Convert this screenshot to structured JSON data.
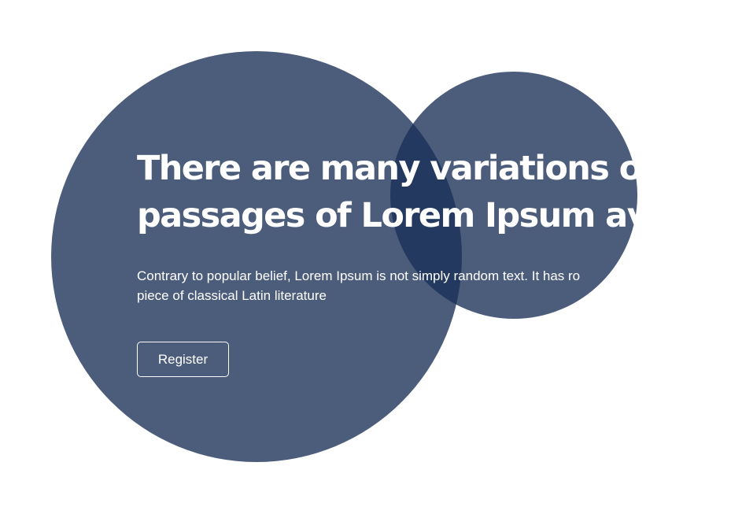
{
  "hero": {
    "headline_line1": "There are many variations of",
    "headline_line2": "passages of Lorem Ipsum ava",
    "description_line1": "Contrary to popular belief, Lorem Ipsum is not simply random text. It has ro",
    "description_line2": "piece of classical Latin literature",
    "register_label": "Register"
  },
  "colors": {
    "background": "#ffffff",
    "circle": "#4a5d7b",
    "circle_overlap": "#293b61",
    "text": "#ffffff"
  }
}
